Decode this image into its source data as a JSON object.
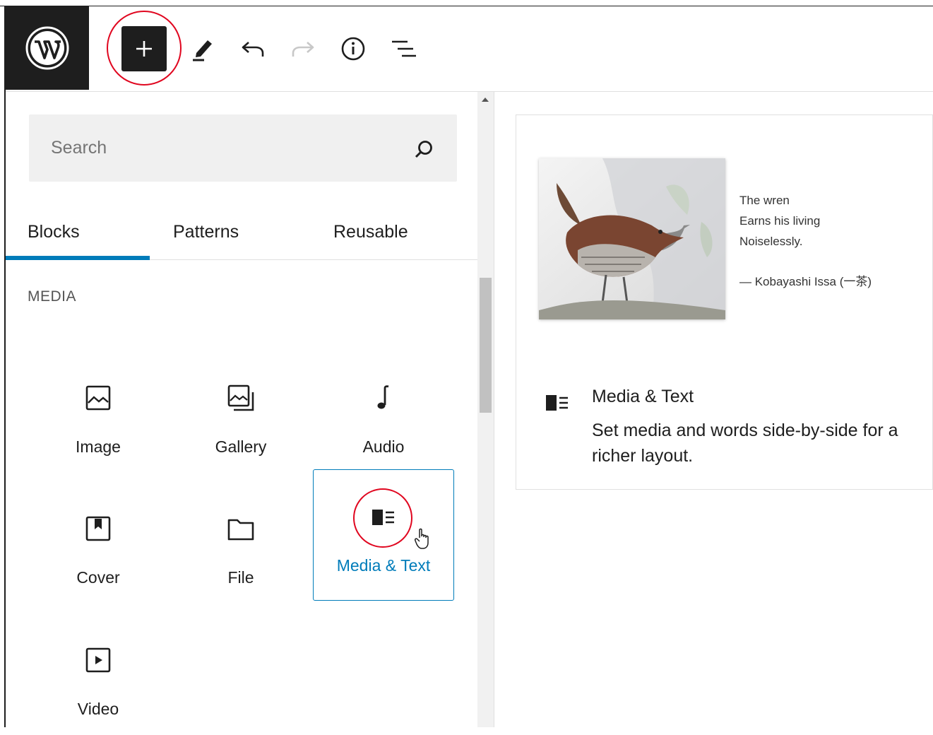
{
  "toolbar": {
    "logo_icon": "wordpress-logo-icon",
    "add_block_icon": "plus-icon",
    "tools_icon": "pencil-icon",
    "undo_icon": "undo-icon",
    "redo_icon": "redo-icon",
    "details_icon": "info-icon",
    "list_view_icon": "list-view-icon",
    "highlight_color": "#e0061f"
  },
  "inserter": {
    "search": {
      "placeholder": "Search",
      "value": ""
    },
    "tabs": [
      {
        "label": "Blocks",
        "active": true
      },
      {
        "label": "Patterns",
        "active": false
      },
      {
        "label": "Reusable",
        "active": false
      }
    ],
    "category": "MEDIA",
    "blocks": [
      {
        "label": "Image",
        "icon": "image-icon"
      },
      {
        "label": "Gallery",
        "icon": "gallery-icon"
      },
      {
        "label": "Audio",
        "icon": "audio-icon"
      },
      {
        "label": "Cover",
        "icon": "cover-icon"
      },
      {
        "label": "File",
        "icon": "file-icon"
      },
      {
        "label": "Media & Text",
        "icon": "media-text-icon",
        "selected": true
      },
      {
        "label": "Video",
        "icon": "video-icon"
      }
    ],
    "accent_color": "#007cba"
  },
  "preview": {
    "image": "wren-bird-illustration",
    "poem": [
      "The wren",
      "Earns his living",
      "Noiselessly."
    ],
    "attribution": "— Kobayashi Issa (一茶)",
    "title": "Media & Text",
    "description": "Set media and words side-by-side for a richer layout.",
    "icon": "media-text-icon"
  }
}
